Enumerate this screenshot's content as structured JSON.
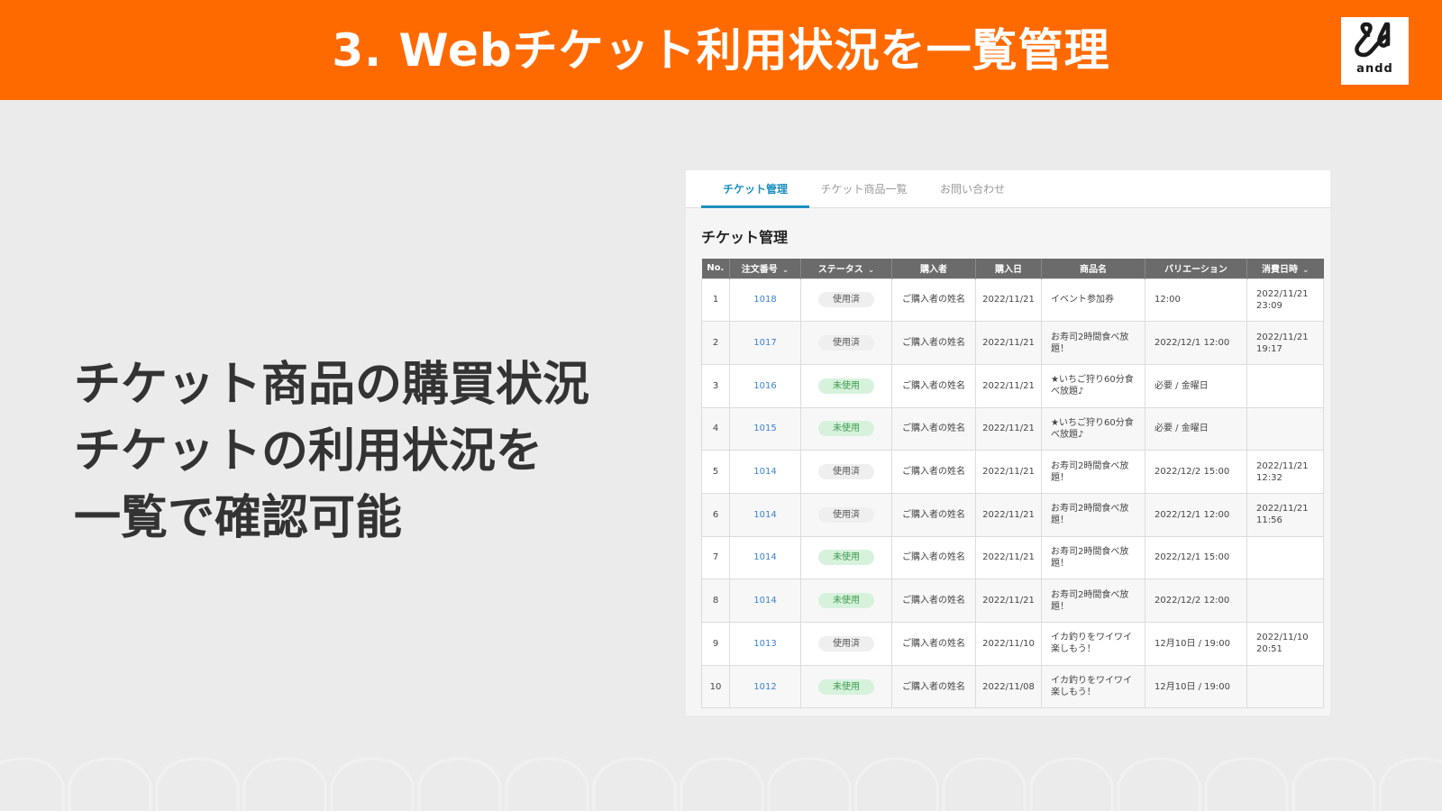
{
  "header": {
    "title": "3. Webチケット利用状況を一覧管理",
    "logo_text": "andd",
    "brand_color": "#ff6a00"
  },
  "copy": {
    "lines": [
      "チケット商品の購買状況",
      "チケットの利用状況を",
      "一覧で確認可能"
    ]
  },
  "app": {
    "tabs": [
      {
        "label": "チケット管理",
        "active": true
      },
      {
        "label": "チケット商品一覧",
        "active": false
      },
      {
        "label": "お問い合わせ",
        "active": false
      }
    ],
    "section_title": "チケット管理",
    "accent_color": "#1b8fc0",
    "table": {
      "columns": [
        {
          "label": "No.",
          "sortable": false
        },
        {
          "label": "注文番号",
          "sortable": true
        },
        {
          "label": "ステータス",
          "sortable": true
        },
        {
          "label": "購入者",
          "sortable": false
        },
        {
          "label": "購入日",
          "sortable": false
        },
        {
          "label": "商品名",
          "sortable": false
        },
        {
          "label": "バリエーション",
          "sortable": false
        },
        {
          "label": "消費日時",
          "sortable": true
        }
      ],
      "rows": [
        {
          "no": "1",
          "order": "1018",
          "status": "使用済",
          "used": true,
          "buyer": "ご購入者の姓名",
          "date": "2022/11/21",
          "product": "イベント参加券",
          "variation": "12:00",
          "consumed": "2022/11/21 23:09"
        },
        {
          "no": "2",
          "order": "1017",
          "status": "使用済",
          "used": true,
          "buyer": "ご購入者の姓名",
          "date": "2022/11/21",
          "product": "お寿司2時間食べ放題！",
          "variation": "2022/12/1 12:00",
          "consumed": "2022/11/21 19:17"
        },
        {
          "no": "3",
          "order": "1016",
          "status": "未使用",
          "used": false,
          "buyer": "ご購入者の姓名",
          "date": "2022/11/21",
          "product": "★いちご狩り60分食べ放題♪",
          "variation": "必要 / 金曜日",
          "consumed": ""
        },
        {
          "no": "4",
          "order": "1015",
          "status": "未使用",
          "used": false,
          "buyer": "ご購入者の姓名",
          "date": "2022/11/21",
          "product": "★いちご狩り60分食べ放題♪",
          "variation": "必要 / 金曜日",
          "consumed": ""
        },
        {
          "no": "5",
          "order": "1014",
          "status": "使用済",
          "used": true,
          "buyer": "ご購入者の姓名",
          "date": "2022/11/21",
          "product": "お寿司2時間食べ放題！",
          "variation": "2022/12/2 15:00",
          "consumed": "2022/11/21 12:32"
        },
        {
          "no": "6",
          "order": "1014",
          "status": "使用済",
          "used": true,
          "buyer": "ご購入者の姓名",
          "date": "2022/11/21",
          "product": "お寿司2時間食べ放題！",
          "variation": "2022/12/1 12:00",
          "consumed": "2022/11/21 11:56"
        },
        {
          "no": "7",
          "order": "1014",
          "status": "未使用",
          "used": false,
          "buyer": "ご購入者の姓名",
          "date": "2022/11/21",
          "product": "お寿司2時間食べ放題！",
          "variation": "2022/12/1 15:00",
          "consumed": ""
        },
        {
          "no": "8",
          "order": "1014",
          "status": "未使用",
          "used": false,
          "buyer": "ご購入者の姓名",
          "date": "2022/11/21",
          "product": "お寿司2時間食べ放題！",
          "variation": "2022/12/2 12:00",
          "consumed": ""
        },
        {
          "no": "9",
          "order": "1013",
          "status": "使用済",
          "used": true,
          "buyer": "ご購入者の姓名",
          "date": "2022/11/10",
          "product": "イカ釣りをワイワイ楽しもう！",
          "variation": "12月10日 / 19:00",
          "consumed": "2022/11/10 20:51"
        },
        {
          "no": "10",
          "order": "1012",
          "status": "未使用",
          "used": false,
          "buyer": "ご購入者の姓名",
          "date": "2022/11/08",
          "product": "イカ釣りをワイワイ楽しもう！",
          "variation": "12月10日 / 19:00",
          "consumed": ""
        }
      ]
    }
  }
}
